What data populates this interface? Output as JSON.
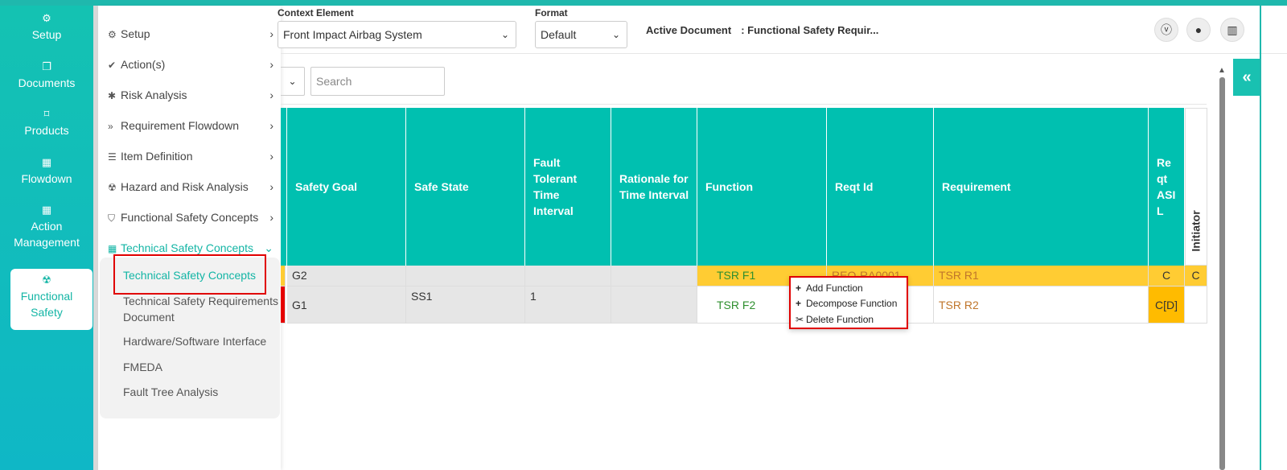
{
  "main_nav": [
    {
      "label": "Setup",
      "icon": "gears-icon"
    },
    {
      "label": "Documents",
      "icon": "copy-icon"
    },
    {
      "label": "Products",
      "icon": "product-icon"
    },
    {
      "label": "Flowdown",
      "icon": "building-icon"
    },
    {
      "label": "Action Management",
      "icon": "building-icon"
    },
    {
      "label": "Functional Safety",
      "icon": "radiation-icon",
      "active": true
    }
  ],
  "submenu": {
    "items": [
      {
        "label": "Setup",
        "icon": "gears-icon"
      },
      {
        "label": "Action(s)",
        "icon": "check-icon"
      },
      {
        "label": "Risk Analysis",
        "icon": "bug-icon"
      },
      {
        "label": "Requirement Flowdown",
        "icon": "double-chevron-down-icon"
      },
      {
        "label": "Item Definition",
        "icon": "list-icon"
      },
      {
        "label": "Hazard and Risk Analysis",
        "icon": "radiation-icon"
      },
      {
        "label": "Functional Safety Concepts",
        "icon": "shield-icon"
      },
      {
        "label": "Technical Safety Concepts",
        "icon": "building-icon",
        "open": true
      }
    ],
    "children": [
      "Technical Safety Concepts",
      "Technical Safety Requirements Document",
      "Hardware/Software Interface",
      "FMEDA",
      "Fault Tree Analysis"
    ]
  },
  "header": {
    "context_label": "Context Element",
    "context_value": "Front Impact Airbag System",
    "format_label": "Format",
    "format_value": "Default",
    "active_doc_label": "Active Document",
    "active_doc_value": ": Functional Safety Requir..."
  },
  "search": {
    "placeholder": "Search"
  },
  "table": {
    "headers": [
      "Safety Goal",
      "Safe State",
      "Fault Tolerant Time Interval",
      "Rationale for Time Interval",
      "Function",
      "Reqt Id",
      "Requirement",
      "Reqt ASIL",
      "Initiator"
    ],
    "rows": [
      {
        "safety_goal": "G2",
        "safe_state": "",
        "ftti": "",
        "rationale": "",
        "function": "TSR F1",
        "reqt_id": "REQ-RA0001",
        "requirement": "TSR R1",
        "asil": "C",
        "initiator": "C"
      },
      {
        "safety_goal": "G1",
        "safe_state": "SS1",
        "ftti": "1",
        "rationale": "",
        "function": "TSR F2",
        "reqt_id": "",
        "requirement": "TSR R2",
        "asil": "C[D]",
        "initiator": ""
      }
    ]
  },
  "context_menu": [
    {
      "label": "Add Function",
      "icon": "plus-icon"
    },
    {
      "label": "Decompose Function",
      "icon": "plus-icon"
    },
    {
      "label": "Delete Function",
      "icon": "scissors-icon"
    }
  ],
  "colors": {
    "accent": "#00c0b0",
    "highlight_red": "#e00000",
    "row_yellow": "#ffcc33"
  }
}
